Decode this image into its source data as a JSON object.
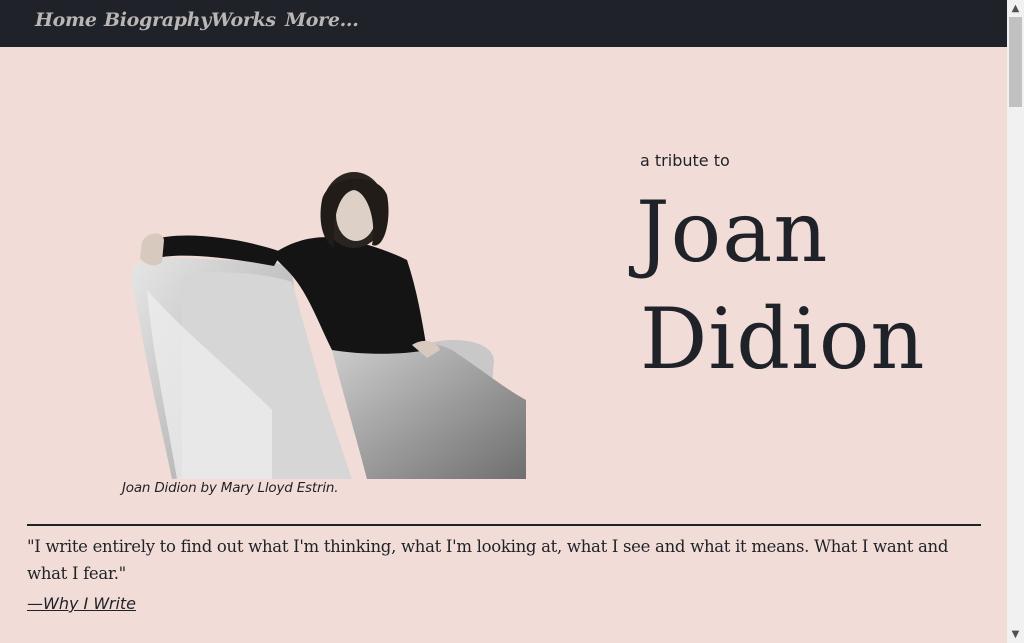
{
  "nav": {
    "items": [
      {
        "label": "Home"
      },
      {
        "label": "Biography"
      },
      {
        "label": "Works"
      },
      {
        "label": "More..."
      }
    ]
  },
  "hero": {
    "tribute_label": "a tribute to",
    "title_line_1": "Joan",
    "title_line_2": "Didion",
    "photo_caption": "Joan Didion by Mary Lloyd Estrin."
  },
  "quote": {
    "text": "\"I write entirely to find out what I'm thinking, what I'm looking at, what I see and what it means. What I want and what I fear.\"",
    "source": "—Why I Write"
  },
  "colors": {
    "background": "#f1dcd7",
    "navbar": "#1f2228",
    "nav_text": "#b9b6b4",
    "text": "#1f2228"
  }
}
